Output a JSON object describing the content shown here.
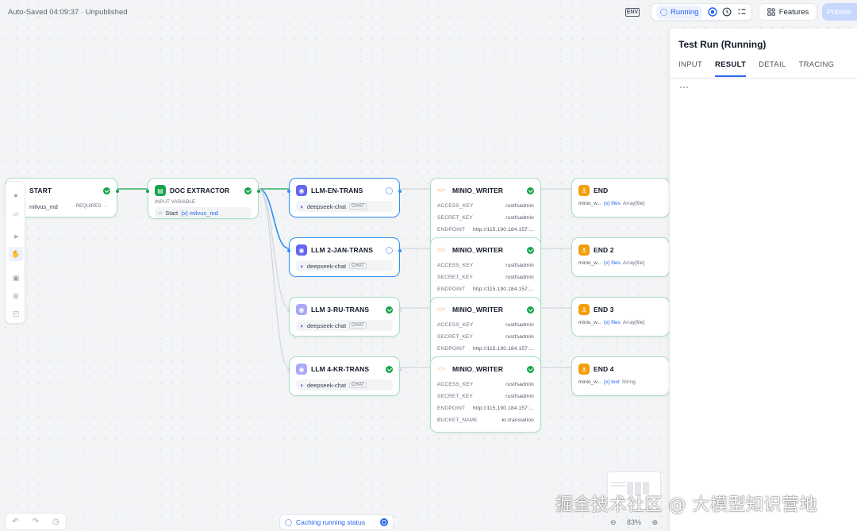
{
  "header": {
    "autosave": "Auto-Saved 04:09:37 · Unpublished",
    "env_label": "ENV",
    "running_label": "Running",
    "features_label": "Features",
    "publish_label": "Publish"
  },
  "nodes": {
    "start": {
      "title": "START",
      "var_name": "milvus_md",
      "required_label": "REQUIRED"
    },
    "doc_extractor": {
      "title": "DOC EXTRACTOR",
      "input_label": "INPUT VARIABLE",
      "source": "Start",
      "var_ref": "{x} milvus_md"
    },
    "llm_en": {
      "title": "LLM-EN-TRANS",
      "model": "deepseek-chat",
      "mode": "CHAT"
    },
    "llm_jan": {
      "title": "LLM 2-JAN-TRANS",
      "model": "deepseek-chat",
      "mode": "CHAT"
    },
    "llm_ru": {
      "title": "LLM 3-RU-TRANS",
      "model": "deepseek-chat",
      "mode": "CHAT"
    },
    "llm_kr": {
      "title": "LLM 4-KR-TRANS",
      "model": "deepseek-chat",
      "mode": "CHAT"
    },
    "writer_label": "MINIO_WRITER",
    "writer_fields": {
      "access_key_label": "ACCESS_KEY",
      "access_key_value": "rustfsadmin",
      "secret_key_label": "SECRET_KEY",
      "secret_key_value": "rustfsadmin",
      "endpoint_label": "ENDPOINT",
      "endpoint_value": "http://115.190.184.157:...",
      "bucket_label": "BUCKET_NAME",
      "bucket_value": "kr-translation"
    },
    "end1": {
      "title": "END",
      "source": "minio_w...",
      "var": "{x} files",
      "type": "Array[file]"
    },
    "end2": {
      "title": "END 2",
      "source": "minio_w...",
      "var": "{x} files",
      "type": "Array[file]"
    },
    "end3": {
      "title": "END 3",
      "source": "minio_w...",
      "var": "{x} files",
      "type": "Array[file]"
    },
    "end4": {
      "title": "END 4",
      "source": "minio_w...",
      "var": "{x} text",
      "type": "String"
    }
  },
  "panel": {
    "title": "Test Run (Running)",
    "tabs": [
      "INPUT",
      "RESULT",
      "DETAIL",
      "TRACING"
    ],
    "active_tab": "RESULT"
  },
  "bottom": {
    "caching_label": "Caching running status",
    "zoom_label": "83%"
  },
  "watermark": "掘金技术社区 @ 大模型知识营地",
  "colors": {
    "accent": "#2563eb",
    "success": "#16a34a",
    "node_border": "#a7e0c2",
    "active_border": "#2e90fa"
  }
}
